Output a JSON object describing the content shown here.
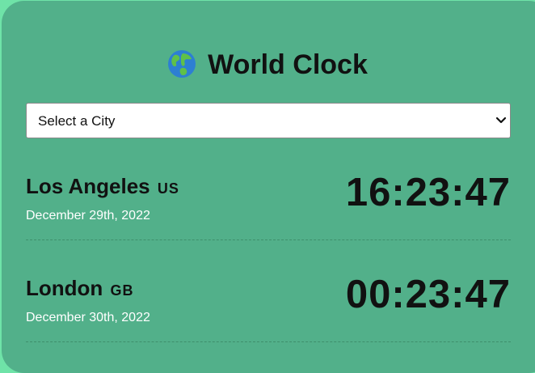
{
  "app": {
    "title": "World Clock",
    "icon": "globe-americas-icon"
  },
  "city_select": {
    "selected": "Select a City"
  },
  "cities": [
    {
      "name": "Los Angeles",
      "country": "US",
      "date": "December 29th, 2022",
      "time": "16:23:47"
    },
    {
      "name": "London",
      "country": "GB",
      "date": "December 30th, 2022",
      "time": "00:23:47"
    }
  ],
  "colors": {
    "background": "#6fe3a8",
    "card": "#52b08a",
    "text": "#111111"
  }
}
